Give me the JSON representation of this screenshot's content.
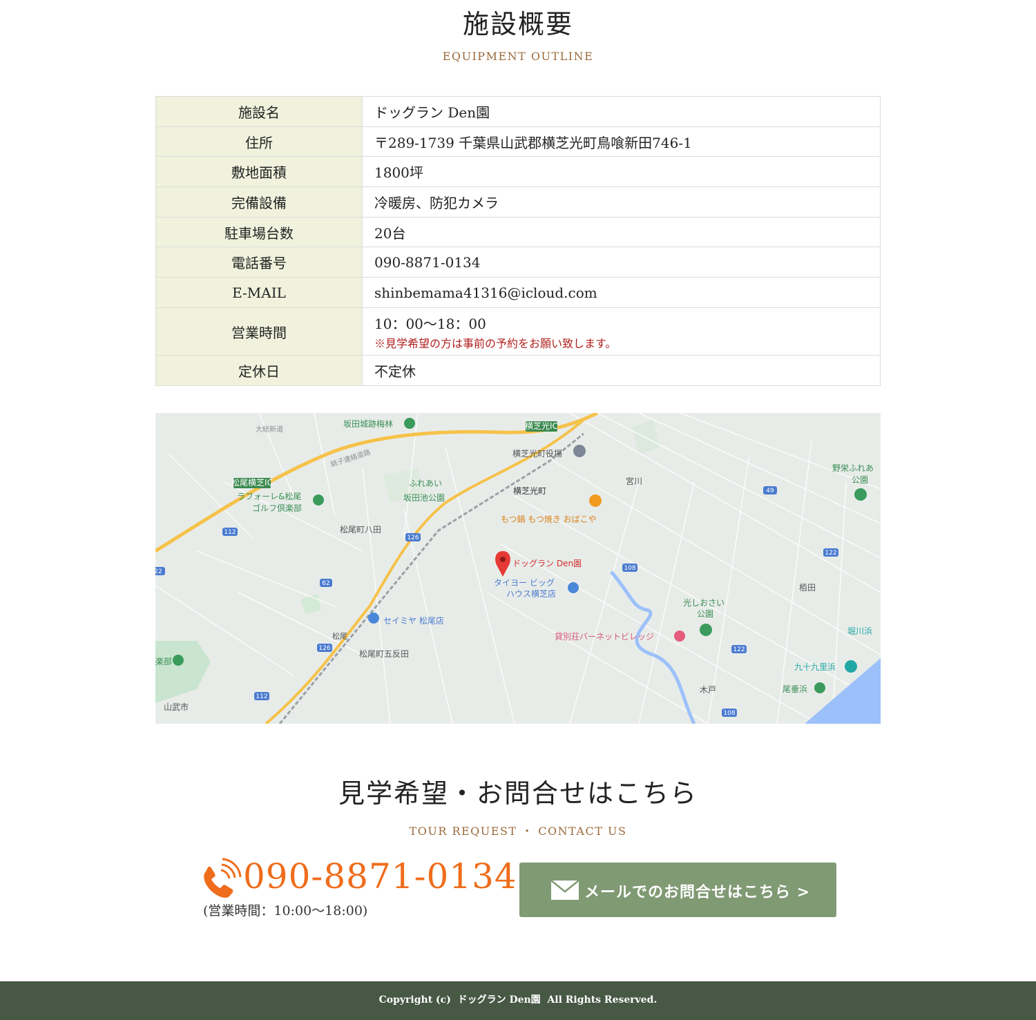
{
  "outline": {
    "title": "施設概要",
    "subtitle": "EQUIPMENT OUTLINE",
    "rows": [
      {
        "label": "施設名",
        "value": "ドッグラン Den園"
      },
      {
        "label": "住所",
        "value": "〒289-1739 千葉県山武郡横芝光町鳥喰新田746-1"
      },
      {
        "label": "敷地面積",
        "value": "1800坪"
      },
      {
        "label": "完備設備",
        "value": "冷暖房、防犯カメラ"
      },
      {
        "label": "駐車場台数",
        "value": "20台"
      },
      {
        "label": "電話番号",
        "value": "090-8871-0134"
      },
      {
        "label": "E-MAIL",
        "value": "shinbemama41316@icloud.com"
      },
      {
        "label": "営業時間",
        "value": "10：00〜18：00",
        "note": "※見学希望の方は事前の予約をお願い致します。"
      },
      {
        "label": "定休日",
        "value": "不定休"
      }
    ]
  },
  "map": {
    "marker_label": "ドッグラン Den園",
    "labels": {
      "sakata_ume": "坂田城跡梅林",
      "yokoshiba_ic": "横芝光IC",
      "daiso": "大総新道",
      "choshi": "銚子連絡道路",
      "yakuba": "横芝光町役場",
      "matsuo_ic": "松尾横芝IC",
      "fureai1": "ふれあい",
      "fureai2": "坂田池公園",
      "miyagawa": "宮川",
      "noei1": "野栄ふれあ",
      "noei2": "公園",
      "lafore1": "ラフォーレ&松尾",
      "lafore2": "ゴルフ倶楽部",
      "yokoshiba": "横芝光町",
      "motsunabe": "もつ鍋 もつ焼き おばこや",
      "hachinohe": "松尾町八田",
      "taiyo1": "タイヨー ビッグ",
      "taiyo2": "ハウス横芝店",
      "seimiya": "セイミヤ 松尾店",
      "matsuo": "松尾",
      "hikari1": "光しおさい",
      "hikari2": "公園",
      "tochida": "栢田",
      "kashibeso": "貸別荘バーネットビレッジ",
      "horikawa": "堀川浜",
      "gotanda": "松尾町五反田",
      "bu": "楽部",
      "kukuri": "九十九里浜",
      "odaruhama": "尾垂浜",
      "kido": "木戸",
      "sammu": "山武市"
    },
    "routes": [
      "49",
      "112",
      "126",
      "62",
      "108",
      "122",
      "122",
      "126",
      "112",
      "108",
      "22"
    ],
    "colors": {
      "water": "#9cc0f9",
      "park": "#c9e5cf",
      "highway": "#f5c24a",
      "marker": "#e53935"
    }
  },
  "contact": {
    "title": "見学希望・お問合せはこちら",
    "subtitle": "TOUR REQUEST ・ CONTACT US",
    "phone": "090-8871-0134",
    "hours": "(営業時間：10:00〜18:00)",
    "mail_button": "メールでのお問合せはこちら >"
  },
  "footer": {
    "copyright": "Copyright (c)  ドッグラン Den園  All Rights Reserved."
  },
  "colors": {
    "accent_orange": "#ef6d1c",
    "table_header_bg": "#f0f2dd",
    "button_green": "#809a74",
    "footer_bg": "#475845",
    "subtitle_brown": "#9a6a3a"
  }
}
